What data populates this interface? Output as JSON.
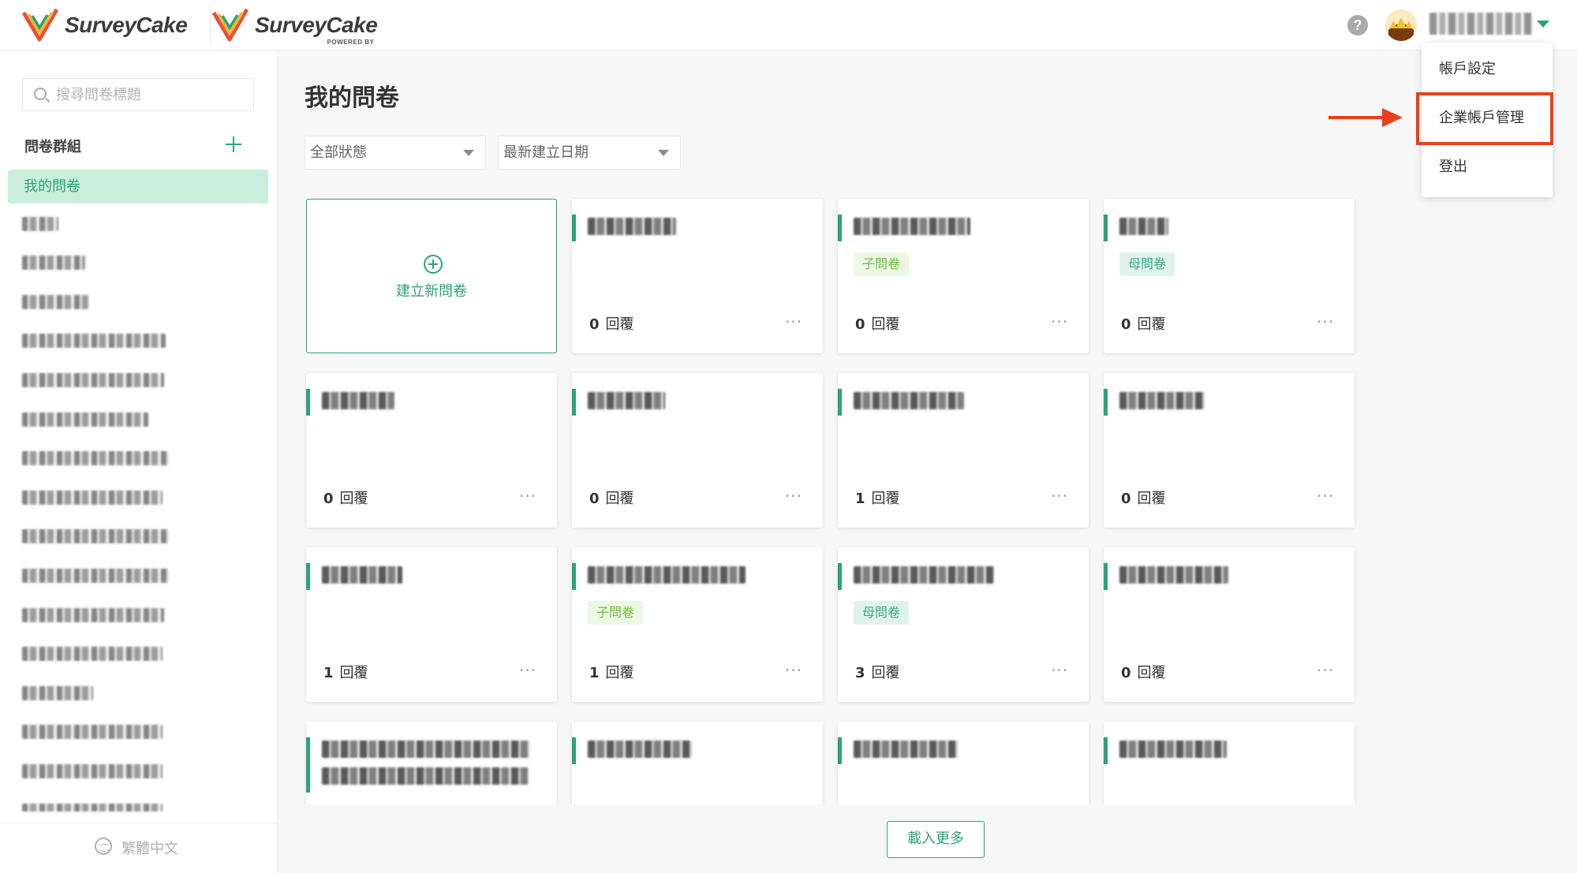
{
  "header": {
    "logo_text": "SurveyCake",
    "logo2_text": "SurveyCake",
    "logo2_sub": "POWERED BY",
    "help_icon": "?",
    "user_name_blurred": true
  },
  "account_menu": {
    "items": [
      "帳戶設定",
      "企業帳戶管理",
      "登出"
    ],
    "highlighted_index": 1,
    "annotation_color": "#e8401c"
  },
  "sidebar": {
    "search_placeholder": "搜尋問卷標題",
    "group_title": "問卷群組",
    "active_item": "我的問卷",
    "blurred_items_count": 16,
    "language": "繁體中文"
  },
  "main": {
    "title": "我的問卷",
    "status_filter": "全部狀態",
    "sort_filter": "最新建立日期",
    "create_label": "建立新問卷",
    "reply_label": "回覆",
    "more_icon": "···",
    "load_more": "載入更多",
    "cards": [
      {
        "replies": "0",
        "badge": ""
      },
      {
        "replies": "0",
        "badge": "子問卷"
      },
      {
        "replies": "0",
        "badge": "母問卷"
      },
      {
        "replies": "0",
        "badge": ""
      },
      {
        "replies": "0",
        "badge": ""
      },
      {
        "replies": "1",
        "badge": ""
      },
      {
        "replies": "0",
        "badge": ""
      },
      {
        "replies": "1",
        "badge": ""
      },
      {
        "replies": "1",
        "badge": "子問卷"
      },
      {
        "replies": "3",
        "badge": "母問卷"
      },
      {
        "replies": "0",
        "badge": ""
      },
      {
        "replies": "",
        "badge": ""
      },
      {
        "replies": "",
        "badge": ""
      },
      {
        "replies": "",
        "badge": ""
      },
      {
        "replies": "",
        "badge": ""
      }
    ]
  },
  "colors": {
    "accent": "#2aa573",
    "active_bg": "#c9eedc",
    "child_badge": "#6cbf3a",
    "parent_badge": "#3daa86"
  }
}
